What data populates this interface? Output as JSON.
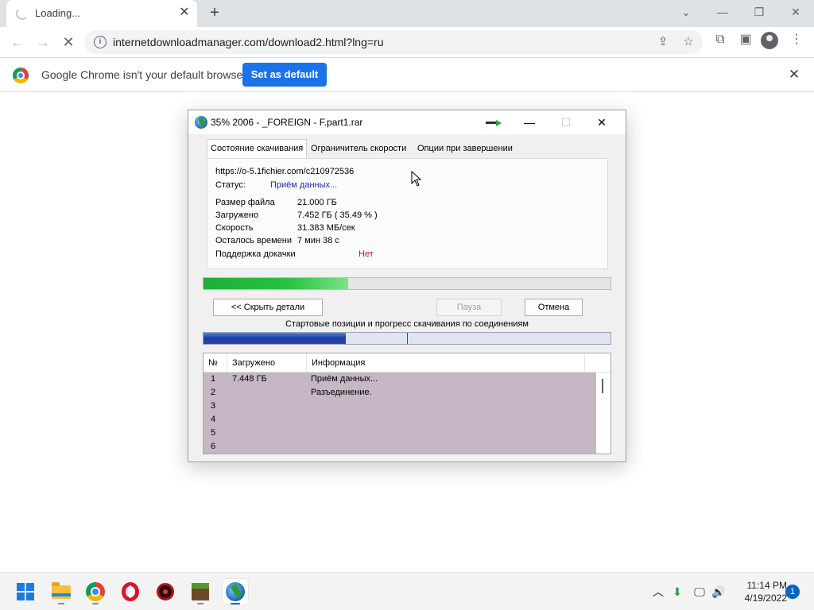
{
  "browser": {
    "tab_title": "Loading...",
    "url": "internetdownloadmanager.com/download2.html?lng=ru",
    "infobar_text": "Google Chrome isn't your default browser",
    "set_default_label": "Set as default"
  },
  "dialog": {
    "title": "35% 2006 - _FOREIGN - F.part1.rar",
    "tabs": [
      "Состояние скачивания",
      "Ограничитель скорости",
      "Опции при завершении"
    ],
    "url": "https://o-5.1fichier.com/c210972536",
    "status_label": "Статус:",
    "status_value": "Приём данных...",
    "rows": [
      {
        "label": "Размер файла",
        "value": "21.000  ГБ"
      },
      {
        "label": "Загружено",
        "value": "7.452  ГБ  ( 35.49 % )"
      },
      {
        "label": "Скорость",
        "value": "31.383  МБ/сек"
      },
      {
        "label": "Осталось времени",
        "value": "7 мин 38 с"
      }
    ],
    "resume_label": "Поддержка докачки",
    "resume_value": "Нет",
    "progress_fraction": 0.3549,
    "hide_details_label": "<< Скрыть детали",
    "pause_label": "Пауза",
    "cancel_label": "Отмена",
    "connections_title": "Стартовые позиции и прогресс скачивания по соединениям",
    "connection_progress_fraction": 0.35,
    "connection_marker_fraction": 0.5,
    "table": {
      "columns": [
        "№",
        "Загружено",
        "Информация"
      ],
      "rows": [
        {
          "n": "1",
          "downloaded": "7.448  ГБ",
          "info": "Приём данных..."
        },
        {
          "n": "2",
          "downloaded": "",
          "info": "Разъединение."
        },
        {
          "n": "3",
          "downloaded": "",
          "info": ""
        },
        {
          "n": "4",
          "downloaded": "",
          "info": ""
        },
        {
          "n": "5",
          "downloaded": "",
          "info": ""
        },
        {
          "n": "6",
          "downloaded": "",
          "info": ""
        }
      ]
    }
  },
  "taskbar": {
    "time": "11:14 PM",
    "date": "4/19/2022",
    "notification_count": "1",
    "apps": [
      "windows-start",
      "file-explorer",
      "chrome",
      "opera",
      "gear-app",
      "minecraft",
      "idm"
    ]
  },
  "colors": {
    "chrome_blue": "#1a73e8",
    "progress_green": "#27c441",
    "status_blue": "#1a2ea8",
    "resume_red": "#c8102e",
    "connection_blue": "#1e3fa3",
    "table_row_bg": "#c6b7c4"
  },
  "icons": [
    "tab-spinner-icon",
    "close-icon",
    "plus-icon",
    "back-icon",
    "forward-icon",
    "stop-icon",
    "info-icon",
    "share-icon",
    "star-icon",
    "puzzle-icon",
    "sidepanel-icon",
    "profile-icon",
    "menu-icon",
    "chrome-logo-icon",
    "idm-logo-icon",
    "arrow-icon",
    "cursor-icon"
  ]
}
